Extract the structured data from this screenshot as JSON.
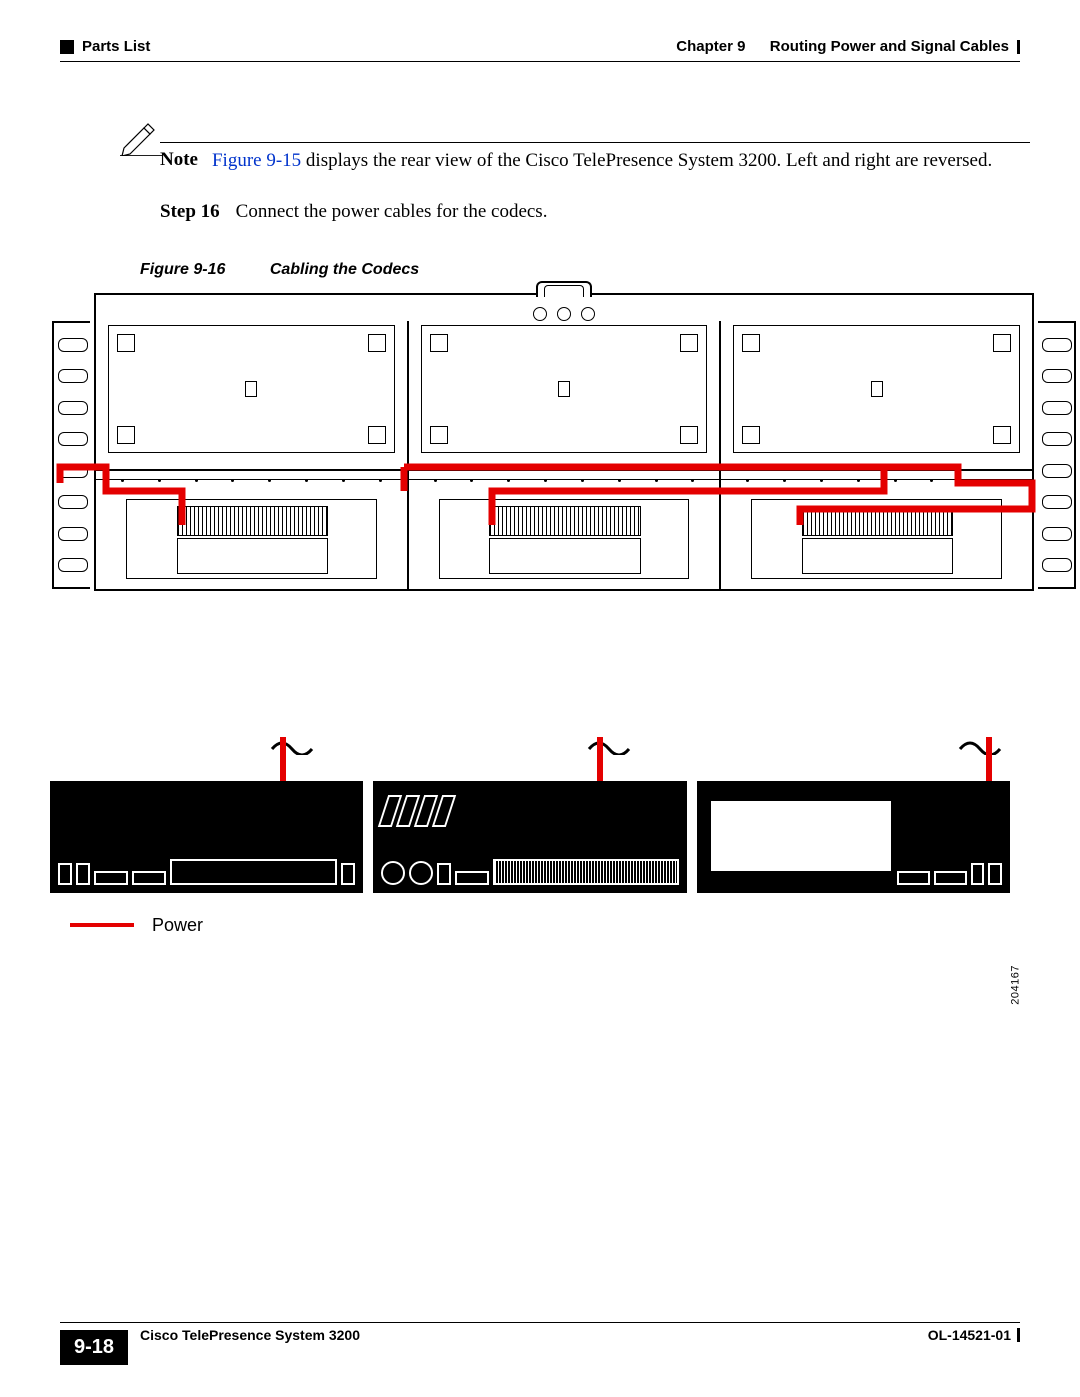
{
  "header": {
    "section_marker_left": "Parts List",
    "chapter_label": "Chapter 9",
    "chapter_title": "Routing Power and Signal Cables"
  },
  "note": {
    "label": "Note",
    "link_text": "Figure 9-15",
    "body_after_link": " displays the rear view of the Cisco TelePresence System 3200. Left and right are reversed."
  },
  "step": {
    "label": "Step 16",
    "text": "Connect the power cables for the codecs."
  },
  "figure": {
    "number": "Figure 9-16",
    "title": "Cabling the Codecs"
  },
  "legend": {
    "item1": "Power"
  },
  "drawing_number": "204167",
  "footer": {
    "product": "Cisco TelePresence System 3200",
    "page_number": "9-18",
    "doc_number": "OL-14521-01"
  }
}
